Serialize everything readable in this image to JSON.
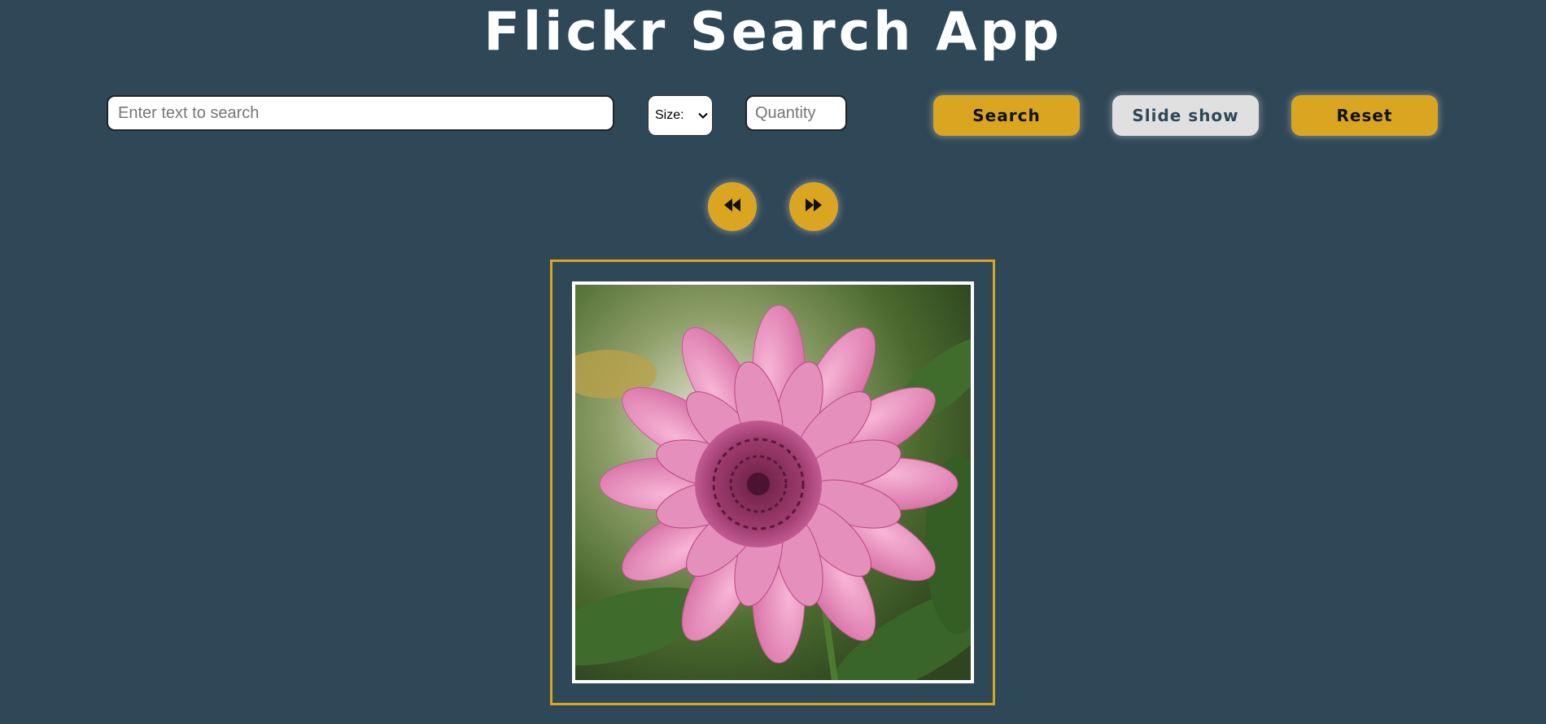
{
  "header": {
    "title": "Flickr Search App"
  },
  "controls": {
    "search_placeholder": "Enter text to search",
    "size_selected": "Size:",
    "quantity_placeholder": "Quantity",
    "search_label": "Search",
    "slideshow_label": "Slide show",
    "reset_label": "Reset"
  },
  "navigation": {
    "prev_icon": "rewind-icon",
    "next_icon": "fast-forward-icon"
  },
  "gallery": {
    "current_image": "pink-dahlia-flower-photo"
  },
  "colors": {
    "background": "#2f4858",
    "accent": "#daa520",
    "secondary_button": "#e0e0e0",
    "title": "#ffffff"
  }
}
